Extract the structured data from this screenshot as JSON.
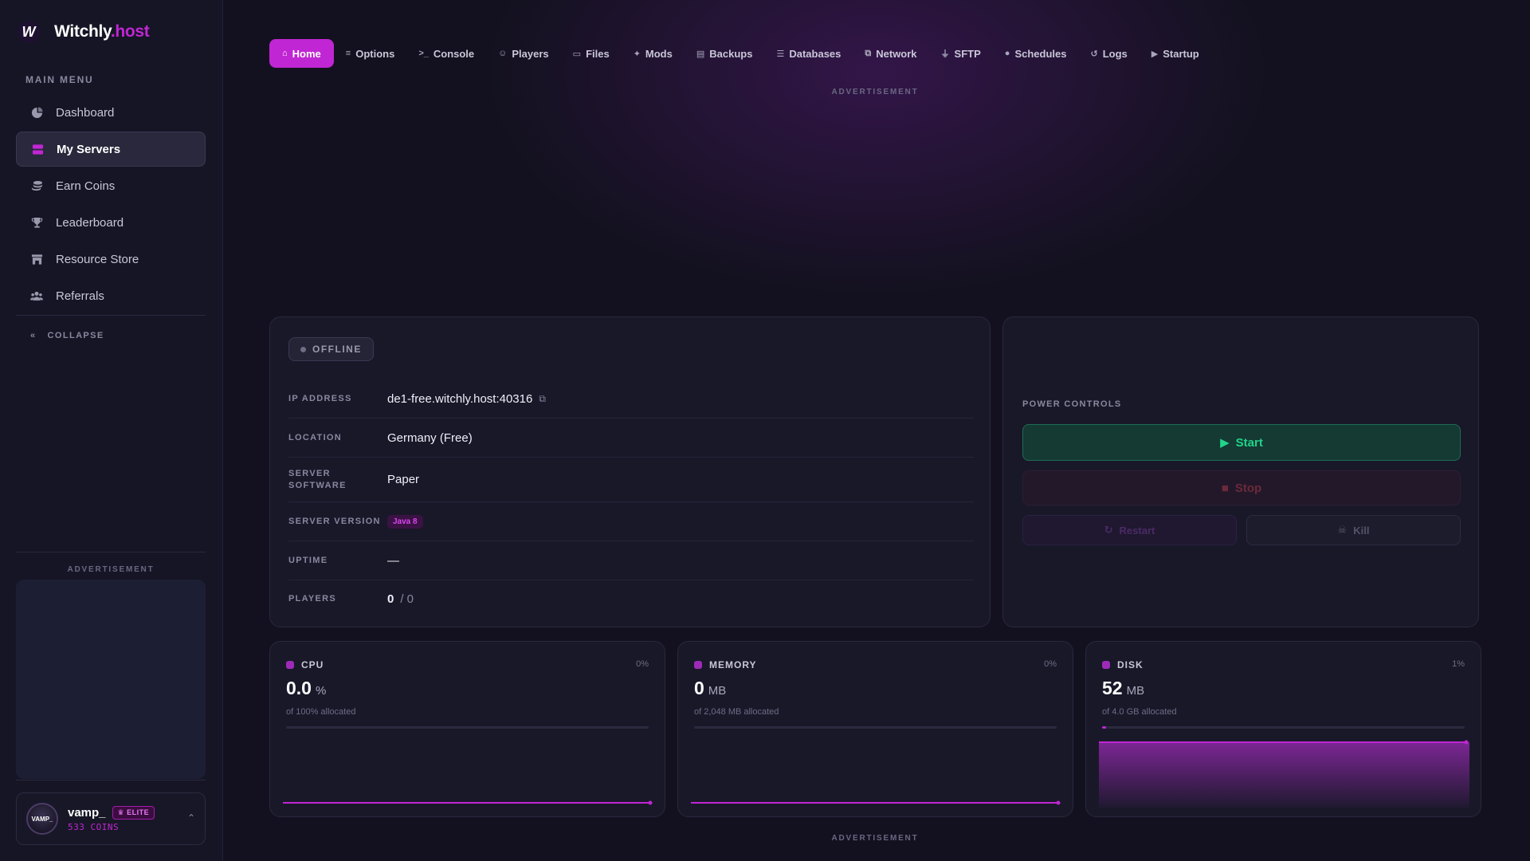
{
  "brand": {
    "name_main": "Witchly",
    "name_accent": ".host",
    "logo_letter": "W"
  },
  "sidebar": {
    "menu_label": "MAIN MENU",
    "items": [
      {
        "label": "Dashboard",
        "icon": "dashboard-icon"
      },
      {
        "label": "My Servers",
        "icon": "servers-icon",
        "active": true
      },
      {
        "label": "Earn Coins",
        "icon": "coins-icon"
      },
      {
        "label": "Leaderboard",
        "icon": "trophy-icon"
      },
      {
        "label": "Resource Store",
        "icon": "store-icon"
      },
      {
        "label": "Referrals",
        "icon": "users-icon"
      }
    ],
    "collapse_label": "COLLAPSE",
    "ad_label": "ADVERTISEMENT"
  },
  "user": {
    "name": "vamp_",
    "badge": "ELITE",
    "coins": "533 COINS",
    "avatar_text": "VAMP_"
  },
  "tabs": [
    {
      "label": "Home",
      "glyph": "⌂",
      "active": true
    },
    {
      "label": "Options",
      "glyph": "≡"
    },
    {
      "label": "Console",
      "glyph": ">_"
    },
    {
      "label": "Players",
      "glyph": "☺"
    },
    {
      "label": "Files",
      "glyph": "▭"
    },
    {
      "label": "Mods",
      "glyph": "✦"
    },
    {
      "label": "Backups",
      "glyph": "▤"
    },
    {
      "label": "Databases",
      "glyph": "☰"
    },
    {
      "label": "Network",
      "glyph": "⧉"
    },
    {
      "label": "SFTP",
      "glyph": "⏚"
    },
    {
      "label": "Schedules",
      "glyph": "●"
    },
    {
      "label": "Logs",
      "glyph": "↺"
    },
    {
      "label": "Startup",
      "glyph": "▶"
    }
  ],
  "ad_label": "ADVERTISEMENT",
  "server": {
    "status": "OFFLINE",
    "info": [
      {
        "key": "IP ADDRESS",
        "value": "de1-free.witchly.host:40316"
      },
      {
        "key": "LOCATION",
        "value": "Germany (Free)"
      },
      {
        "key": "SERVER SOFTWARE",
        "value": "Paper"
      },
      {
        "key": "SERVER VERSION",
        "value": "Java 8"
      },
      {
        "key": "UPTIME",
        "value": "—"
      },
      {
        "key": "PLAYERS",
        "value": "0",
        "value_suffix": "/ 0"
      }
    ]
  },
  "power": {
    "label": "POWER CONTROLS",
    "start": "Start",
    "stop": "Stop",
    "restart": "Restart",
    "kill": "Kill"
  },
  "metrics": [
    {
      "name": "CPU",
      "pct": "0%",
      "value": "0.0",
      "unit": "%",
      "sub": "of 100% allocated",
      "usage_fraction": 0.0
    },
    {
      "name": "MEMORY",
      "pct": "0%",
      "value": "0",
      "unit": "MB",
      "sub": "of 2,048 MB allocated",
      "usage_fraction": 0.0
    },
    {
      "name": "DISK",
      "pct": "1%",
      "value": "52",
      "unit": "MB",
      "sub": "of 4.0 GB allocated",
      "usage_fraction": 0.01
    }
  ],
  "colors": {
    "accent": "#c026d3",
    "start_green": "#22d38a",
    "background": "#13111f"
  }
}
